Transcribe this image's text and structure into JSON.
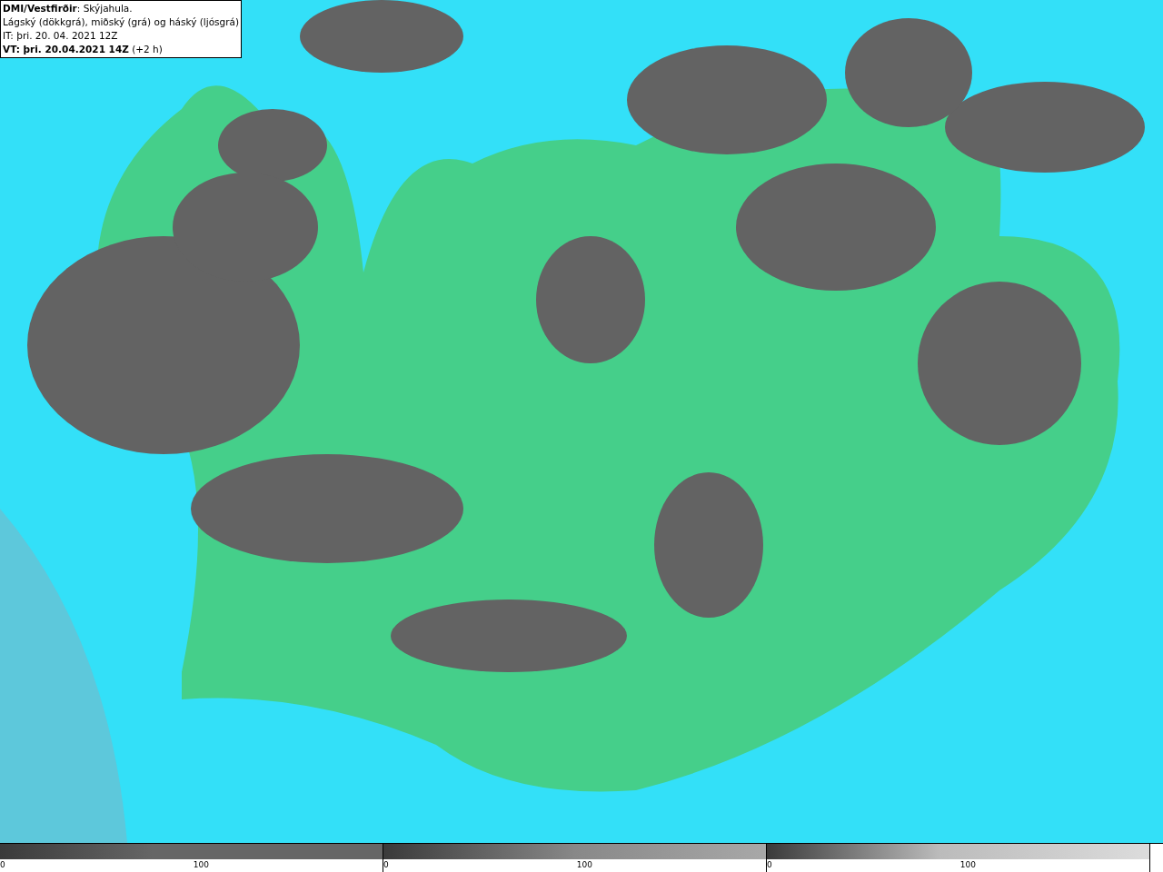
{
  "info_box": {
    "lines": [
      "**DMI/Vestfirðir**: Skýjahula.",
      "Lágský (dökkgrá), miðský (grá) og háský (ljósgrá)",
      "IT: þri. 20. 04. 2021 12Z",
      "**VT: þri. 20.04.2021 14Z** (+2 h)"
    ]
  },
  "legend": [
    {
      "kind": "low",
      "ticks": [
        "0",
        "100"
      ]
    },
    {
      "kind": "mid",
      "ticks": [
        "0",
        "100"
      ]
    },
    {
      "kind": "high",
      "ticks": [
        "0",
        "100"
      ]
    }
  ]
}
